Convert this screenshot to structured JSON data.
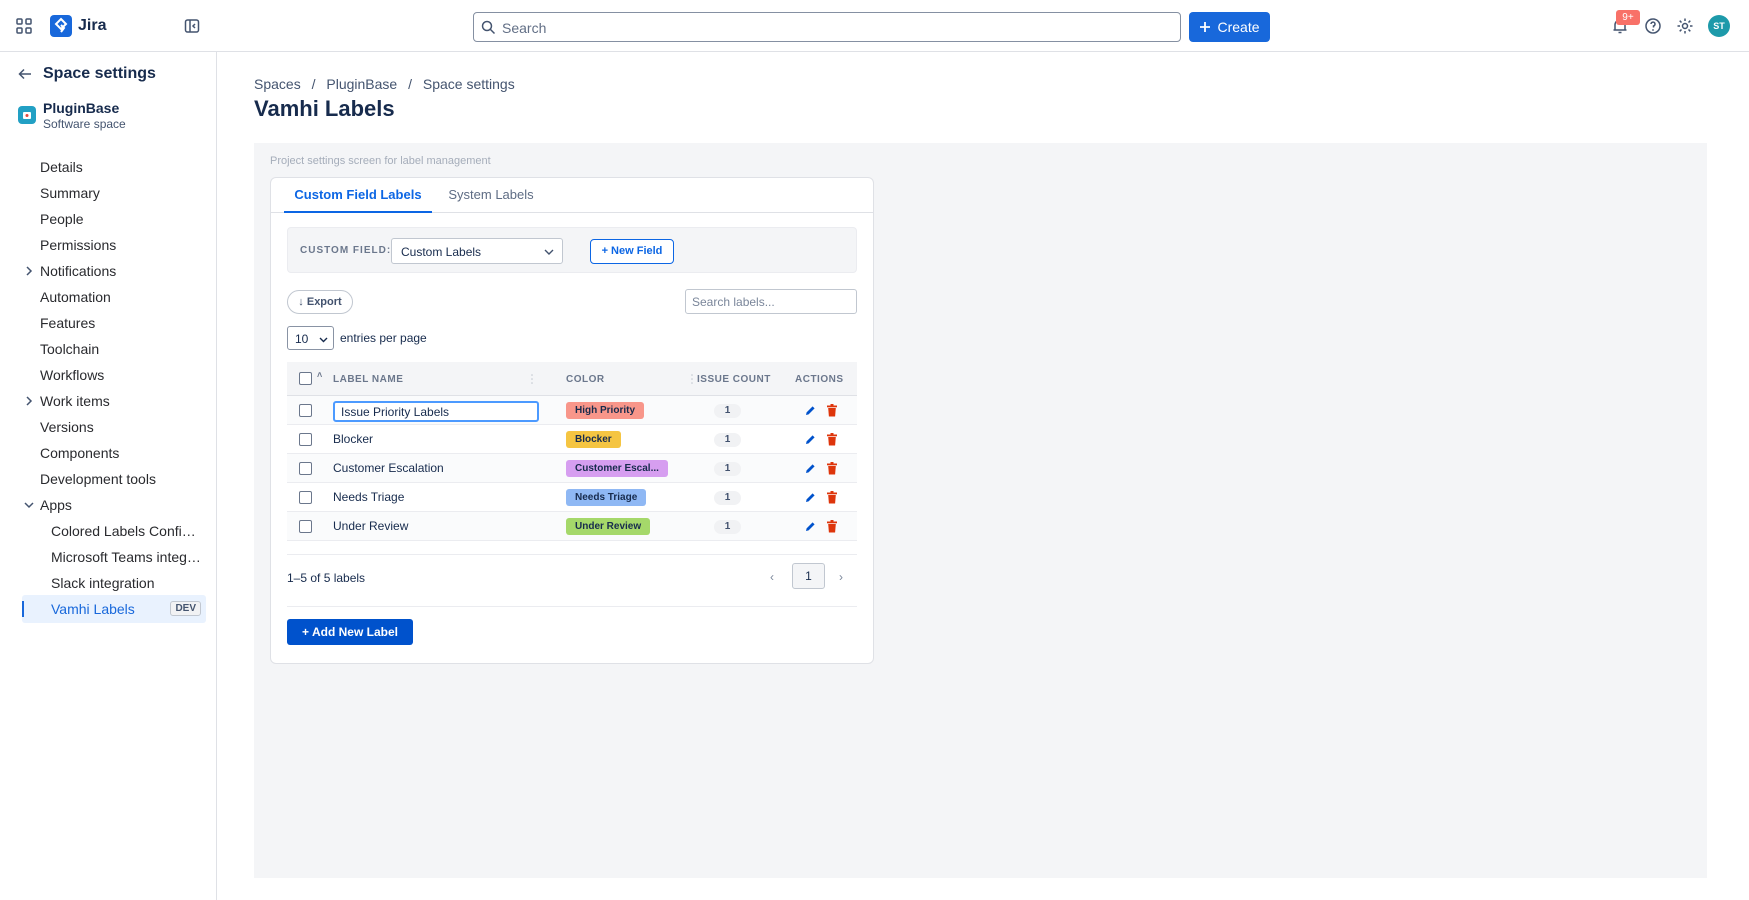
{
  "topbar": {
    "brand": "Jira",
    "search_placeholder": "Search",
    "create_label": "Create",
    "notification_badge": "9+",
    "avatar_initials": "ST"
  },
  "sidebar": {
    "title": "Space settings",
    "project": {
      "name": "PluginBase",
      "type": "Software space"
    },
    "items": [
      {
        "label": "Details"
      },
      {
        "label": "Summary"
      },
      {
        "label": "People"
      },
      {
        "label": "Permissions"
      },
      {
        "label": "Notifications",
        "expandable": true
      },
      {
        "label": "Automation"
      },
      {
        "label": "Features"
      },
      {
        "label": "Toolchain"
      },
      {
        "label": "Workflows"
      },
      {
        "label": "Work items",
        "expandable": true
      },
      {
        "label": "Versions"
      },
      {
        "label": "Components"
      },
      {
        "label": "Development tools"
      },
      {
        "label": "Apps",
        "expanded": true
      }
    ],
    "apps": [
      {
        "label": "Colored Labels Config..."
      },
      {
        "label": "Microsoft Teams integr..."
      },
      {
        "label": "Slack integration"
      },
      {
        "label": "Vamhi Labels",
        "badge": "DEV",
        "active": true
      }
    ]
  },
  "breadcrumb": [
    "Spaces",
    "PluginBase",
    "Space settings"
  ],
  "breadcrumb_sep": "/",
  "page_title": "Vamhi Labels",
  "hint": "Project settings screen for label management",
  "tabs": [
    {
      "label": "Custom Field Labels",
      "active": true
    },
    {
      "label": "System Labels",
      "active": false
    }
  ],
  "field_bar": {
    "label": "CUSTOM FIELD:",
    "selected": "Custom Labels",
    "new_field_label": "+ New Field"
  },
  "toolbar": {
    "export_label": "↓ Export",
    "search_placeholder": "Search labels...",
    "per_page_value": "10",
    "per_page_label": "entries per page"
  },
  "table": {
    "sort_marker": "˄",
    "headers": {
      "name": "LABEL NAME",
      "color": "COLOR",
      "count": "ISSUE COUNT",
      "actions": "ACTIONS"
    },
    "rows": [
      {
        "name": "Issue Priority Labels",
        "editing": true,
        "pill": "High Priority",
        "color": "#f8968a",
        "count": "1"
      },
      {
        "name": "Blocker",
        "pill": "Blocker",
        "color": "#f5c542",
        "count": "1"
      },
      {
        "name": "Customer Escalation",
        "pill": "Customer Escal...",
        "color": "#d69ef0",
        "count": "1"
      },
      {
        "name": "Needs Triage",
        "pill": "Needs Triage",
        "color": "#8fb8f4",
        "count": "1"
      },
      {
        "name": "Under Review",
        "pill": "Under Review",
        "color": "#a5d86a",
        "count": "1"
      }
    ]
  },
  "pagination": {
    "info": "1–5 of 5 labels",
    "prev": "‹",
    "current": "1",
    "next": "›"
  },
  "add_label_button": "+ Add New Label",
  "colors": {
    "accent": "#1868db",
    "primary_button": "#0052cc",
    "delete_icon": "#de350b",
    "edit_icon": "#0052cc"
  }
}
